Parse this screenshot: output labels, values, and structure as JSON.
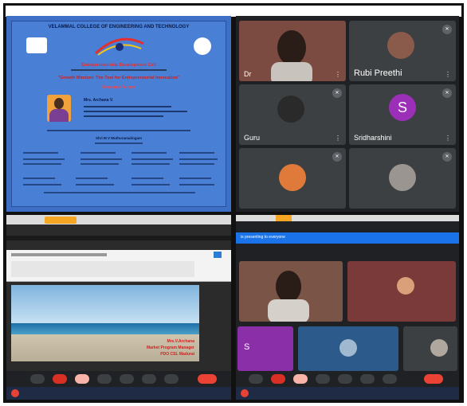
{
  "panel_a": {
    "college": "VELAMMAL COLLEGE OF ENGINEERING AND TECHNOLOGY",
    "cell": "Entrepreneurship Development Cell",
    "topic": "\"Growth Mindset: The Tool for Entrepreneurial Innovation\"",
    "resource_person_label": "Resource Person",
    "speaker_name": "Mrs. Archana V.",
    "welcome": "Shri M V Muthuramalingam"
  },
  "panel_b": {
    "tiles": [
      {
        "name": "Dr"
      },
      {
        "name": "Rubi Preethi"
      },
      {
        "name": "Guru"
      },
      {
        "name": "Sridharshini",
        "initial": "S"
      },
      {
        "name": ""
      },
      {
        "name": ""
      }
    ]
  },
  "panel_c": {
    "slide_lines": [
      "Mrs.V.Archana",
      "Market Program Manager",
      "PDO CSL Madurai"
    ]
  },
  "panel_d": {
    "banner": "is presenting to everyone",
    "tile_initial": "S"
  },
  "colors": {
    "flyer_bg": "#4a7fd6",
    "meet_bg": "#202124",
    "avatar_purple": "#9b2fb8",
    "end_call": "#ea4335"
  }
}
